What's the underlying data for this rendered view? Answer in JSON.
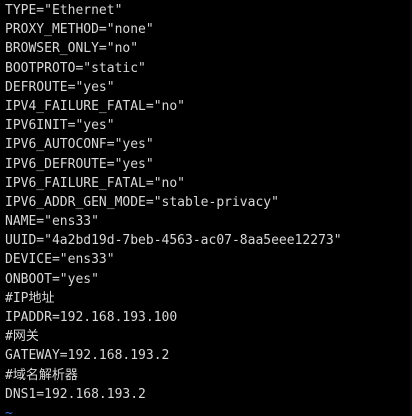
{
  "lines": [
    "TYPE=\"Ethernet\"",
    "PROXY_METHOD=\"none\"",
    "BROWSER_ONLY=\"no\"",
    "BOOTPROTO=\"static\"",
    "DEFROUTE=\"yes\"",
    "IPV4_FAILURE_FATAL=\"no\"",
    "IPV6INIT=\"yes\"",
    "IPV6_AUTOCONF=\"yes\"",
    "IPV6_DEFROUTE=\"yes\"",
    "IPV6_FAILURE_FATAL=\"no\"",
    "IPV6_ADDR_GEN_MODE=\"stable-privacy\"",
    "NAME=\"ens33\"",
    "UUID=\"4a2bd19d-7beb-4563-ac07-8aa5eee12273\"",
    "DEVICE=\"ens33\"",
    "ONBOOT=\"yes\"",
    "#IP地址",
    "IPADDR=192.168.193.100",
    "#网关",
    "GATEWAY=192.168.193.2",
    "#域名解析器",
    "DNS1=192.168.193.2"
  ],
  "empty_line_marker": "~",
  "colors": {
    "background": "#000000",
    "text": "#d8d8d8",
    "tilde": "#3f6fd8"
  }
}
